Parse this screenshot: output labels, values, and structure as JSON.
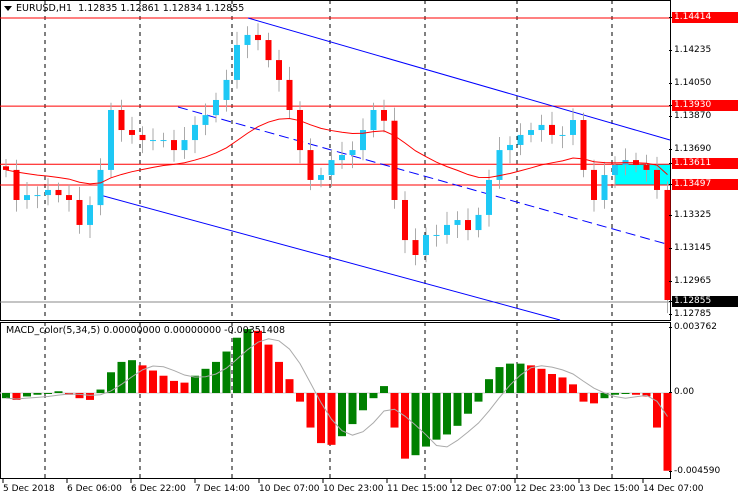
{
  "header": {
    "symbol": "EURUSD,H1",
    "ohlc": "1.12835 1.12861 1.12834 1.12855"
  },
  "macd": {
    "title": "MACD_color(5,34,5) 0.00000000 0.00000000 -0.00351408",
    "axis": [
      {
        "v": 0.003762,
        "label": "0.003762"
      },
      {
        "v": 0,
        "label": "0.00"
      },
      {
        "v": -0.00459,
        "label": "-0.004590"
      }
    ],
    "histogram": [
      -0.0003,
      -0.0004,
      -0.0002,
      -0.0001,
      0.0,
      0.0001,
      -0.0001,
      -0.0003,
      -0.0004,
      0.0002,
      0.0012,
      0.0018,
      0.0019,
      0.0016,
      0.0013,
      0.001,
      0.0007,
      0.0006,
      0.001,
      0.0014,
      0.0018,
      0.0024,
      0.0032,
      0.0037,
      0.0036,
      0.0028,
      0.0018,
      0.0008,
      -0.0005,
      -0.002,
      -0.0029,
      -0.003,
      -0.0025,
      -0.0018,
      -0.001,
      -0.0003,
      0.0004,
      -0.002,
      -0.0038,
      -0.0036,
      -0.0031,
      -0.0027,
      -0.0024,
      -0.0019,
      -0.0012,
      -0.0005,
      0.0008,
      0.0015,
      0.0017,
      0.0017,
      0.0016,
      0.0014,
      0.0011,
      0.0009,
      0.0005,
      -0.0005,
      -0.0006,
      -0.0003,
      -0.0001,
      0.0,
      -0.0001,
      -0.0002,
      -0.002,
      -0.0045
    ]
  },
  "price_axis": [
    {
      "v": 1.14414,
      "label": "1.14414",
      "style": "red"
    },
    {
      "v": 1.14235,
      "label": "1.14235",
      "style": ""
    },
    {
      "v": 1.1405,
      "label": "1.14050",
      "style": ""
    },
    {
      "v": 1.1393,
      "label": "1.13930",
      "style": "red"
    },
    {
      "v": 1.1387,
      "label": "1.13870",
      "style": ""
    },
    {
      "v": 1.1369,
      "label": "1.13690",
      "style": ""
    },
    {
      "v": 1.13611,
      "label": "1.13611",
      "style": "red"
    },
    {
      "v": 1.13497,
      "label": "1.13497",
      "style": "red"
    },
    {
      "v": 1.13325,
      "label": "1.13325",
      "style": ""
    },
    {
      "v": 1.13145,
      "label": "1.13145",
      "style": ""
    },
    {
      "v": 1.12965,
      "label": "1.12965",
      "style": ""
    },
    {
      "v": 1.12855,
      "label": "1.12855",
      "style": "blk"
    },
    {
      "v": 1.12785,
      "label": "1.12785",
      "style": ""
    }
  ],
  "time_axis": [
    "5 Dec 2018",
    "6 Dec 06:00",
    "6 Dec 22:00",
    "7 Dec 14:00",
    "10 Dec 07:00",
    "10 Dec 23:00",
    "11 Dec 15:00",
    "12 Dec 07:00",
    "12 Dec 23:00",
    "13 Dec 15:00",
    "14 Dec 07:00"
  ],
  "levels": {
    "resistance": [
      1.14414,
      1.1393,
      1.13611,
      1.13497
    ],
    "bid": 1.12855,
    "zone": [
      1.13497,
      1.13611
    ]
  },
  "colors": {
    "bull": "#1ec8f5",
    "bear": "#ff0000",
    "level": "#ff0000",
    "channel": "#0000ff",
    "zone": "#00ffff",
    "ma": "#ff0000",
    "macd_up": "#008000",
    "macd_down": "#ff0000"
  },
  "chart_data": {
    "type": "candlestick",
    "title": "EURUSD,H1",
    "closes": [
      1.1358,
      1.13415,
      1.13442,
      1.13442,
      1.1347,
      1.13442,
      1.13415,
      1.13278,
      1.13387,
      1.1358,
      1.13909,
      1.13799,
      1.13772,
      1.13744,
      1.13744,
      1.13744,
      1.13689,
      1.13744,
      1.13827,
      1.13881,
      1.13964,
      1.14074,
      1.14266,
      1.14321,
      1.14293,
      1.14183,
      1.14074,
      1.13909,
      1.13689,
      1.13525,
      1.13552,
      1.13634,
      1.13662,
      1.13689,
      1.13799,
      1.13909,
      1.1385,
      1.13415,
      1.13195,
      1.13113,
      1.13223,
      1.13223,
      1.13278,
      1.13305,
      1.1325,
      1.13333,
      1.13525,
      1.13689,
      1.13717,
      1.13772,
      1.13799,
      1.13827,
      1.13772,
      1.13772,
      1.13854,
      1.1358,
      1.13415,
      1.13552,
      1.13607,
      1.13634,
      1.13607,
      1.1358,
      1.1347,
      1.12866
    ],
    "ylim": [
      1.1276,
      1.145
    ]
  }
}
